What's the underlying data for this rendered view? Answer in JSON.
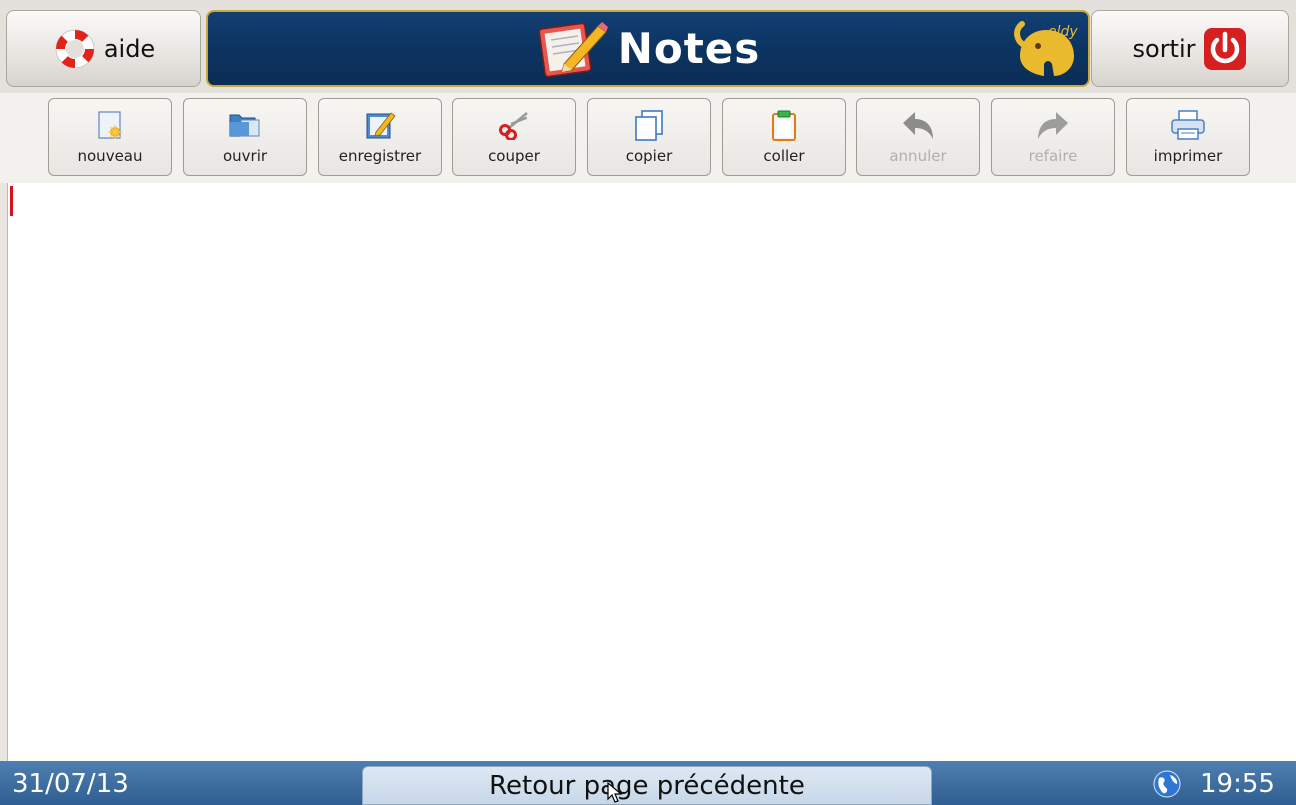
{
  "header": {
    "help_label": "aide",
    "title": "Notes",
    "brand": "eldy",
    "quit_label": "sortir"
  },
  "toolbar": {
    "new_label": "nouveau",
    "open_label": "ouvrir",
    "save_label": "enregistrer",
    "cut_label": "couper",
    "copy_label": "copier",
    "paste_label": "coller",
    "undo_label": "annuler",
    "redo_label": "refaire",
    "print_label": "imprimer"
  },
  "editor": {
    "content": ""
  },
  "footer": {
    "date": "31/07/13",
    "back_label": "Retour page précédente",
    "time": "19:55"
  },
  "icons": {
    "help": "lifebuoy-icon",
    "title": "notepad-pencil-icon",
    "brand": "eldy-elephant-logo",
    "quit": "power-icon",
    "new": "new-file-icon",
    "open": "open-folder-icon",
    "save": "save-edit-icon",
    "cut": "scissors-icon",
    "copy": "copy-icon",
    "paste": "clipboard-icon",
    "undo": "undo-arrow-icon",
    "redo": "redo-arrow-icon",
    "print": "printer-icon",
    "network": "globe-icon"
  },
  "colors": {
    "title_bg": "#0c3360",
    "title_border": "#c8a93d",
    "footer_bg": "#3f6fa2",
    "caret": "#d8121b",
    "power": "#d6201f"
  }
}
